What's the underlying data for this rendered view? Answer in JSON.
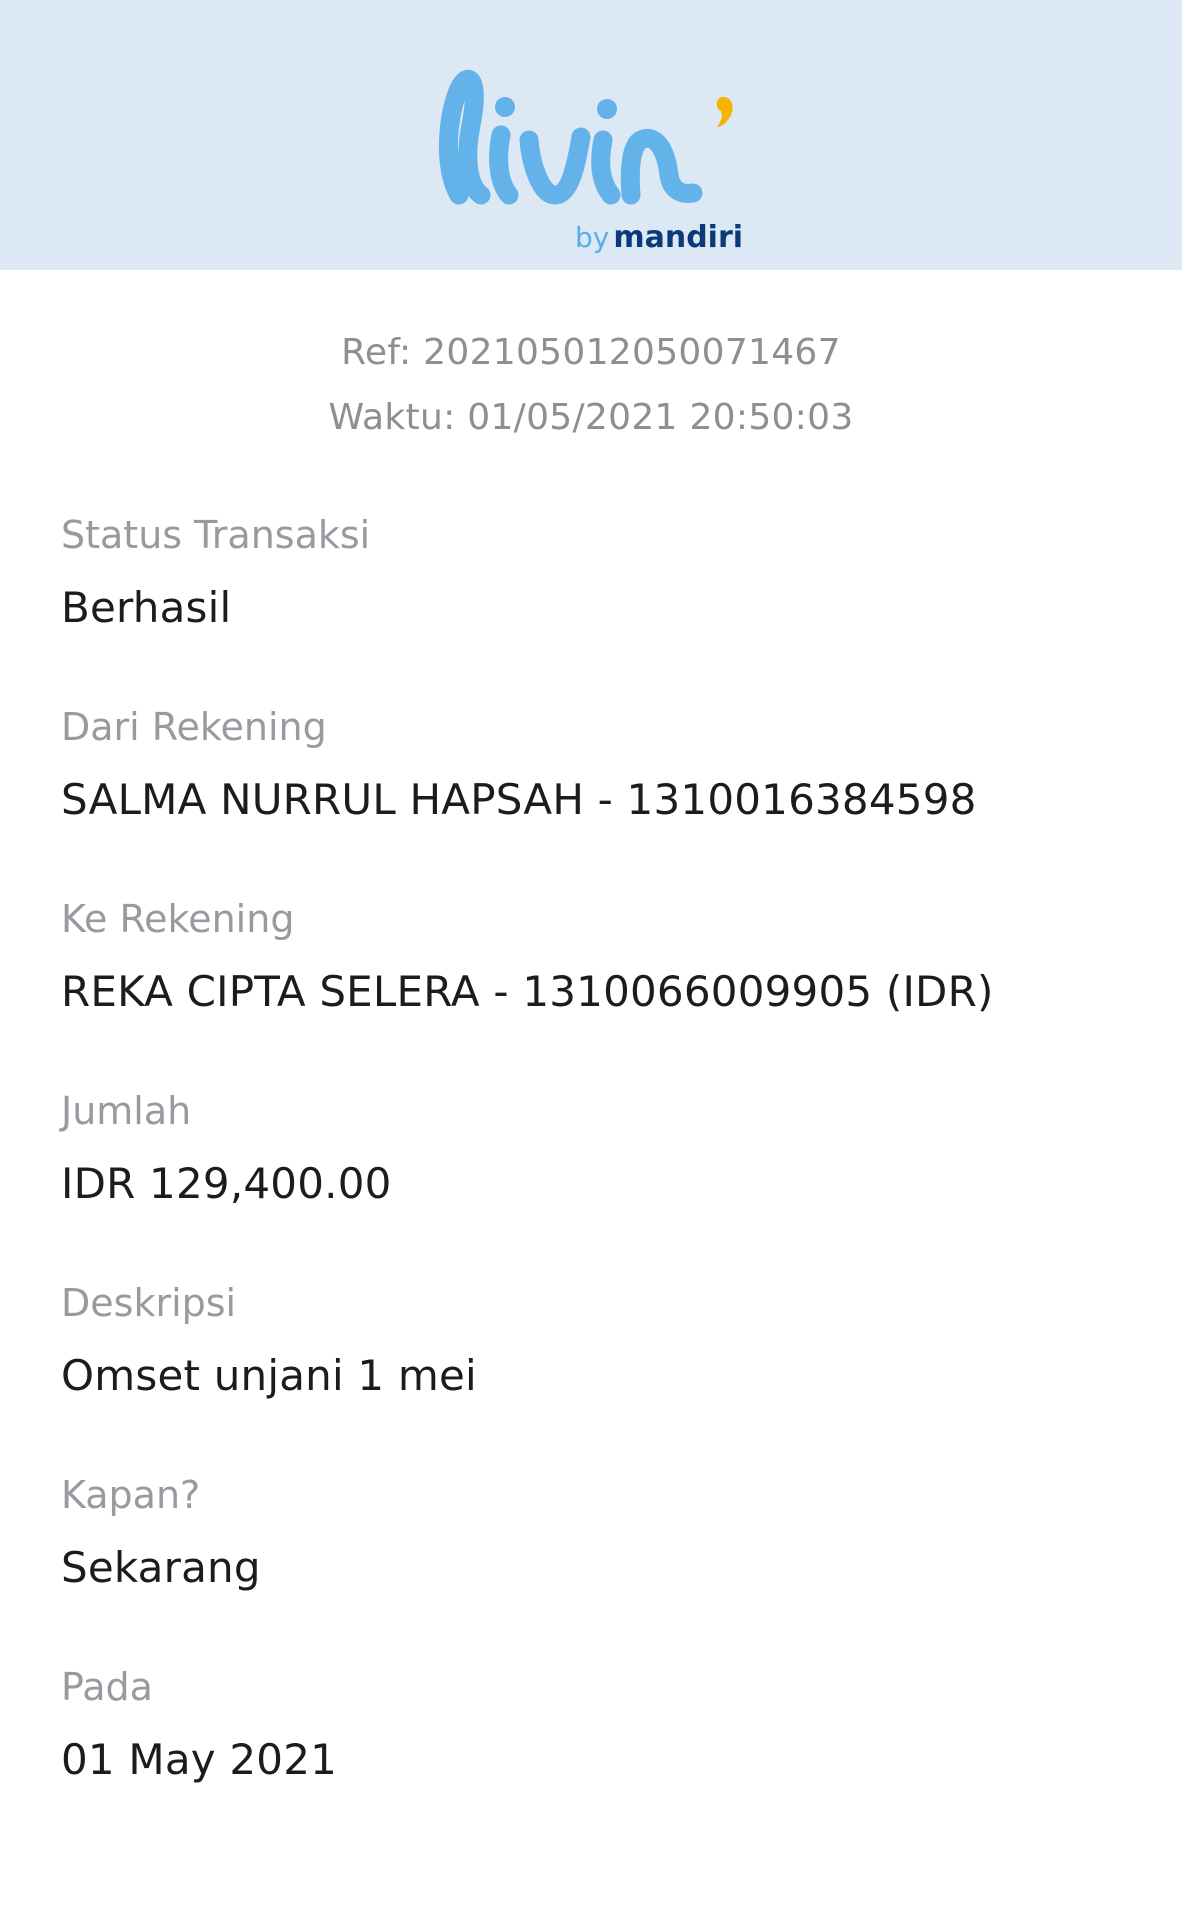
{
  "header": {
    "logo_text": "livin'",
    "logo_by": "by",
    "logo_brand": "mandiri",
    "colors": {
      "background": "#dce8f4",
      "script": "#63b3ea",
      "accent": "#f5b400",
      "brand": "#0a3b78"
    }
  },
  "meta": {
    "ref": "Ref: 20210501205007146 7",
    "time": "Waktu: 01/05/2021 20:50:03"
  },
  "fields": [
    {
      "label": "Status Transaksi",
      "value": "Berhasil"
    },
    {
      "label": "Dari Rekening",
      "value": "SALMA NURRUL HAPSAH - 1310016384598"
    },
    {
      "label": "Ke Rekening",
      "value": "REKA CIPTA SELERA - 1310066009905 (IDR)"
    },
    {
      "label": "Jumlah",
      "value": "IDR 129,400.00"
    },
    {
      "label": "Deskripsi",
      "value": "Omset unjani 1 mei"
    },
    {
      "label": "Kapan?",
      "value": "Sekarang"
    },
    {
      "label": "Pada",
      "value": "01 May 2021"
    }
  ]
}
